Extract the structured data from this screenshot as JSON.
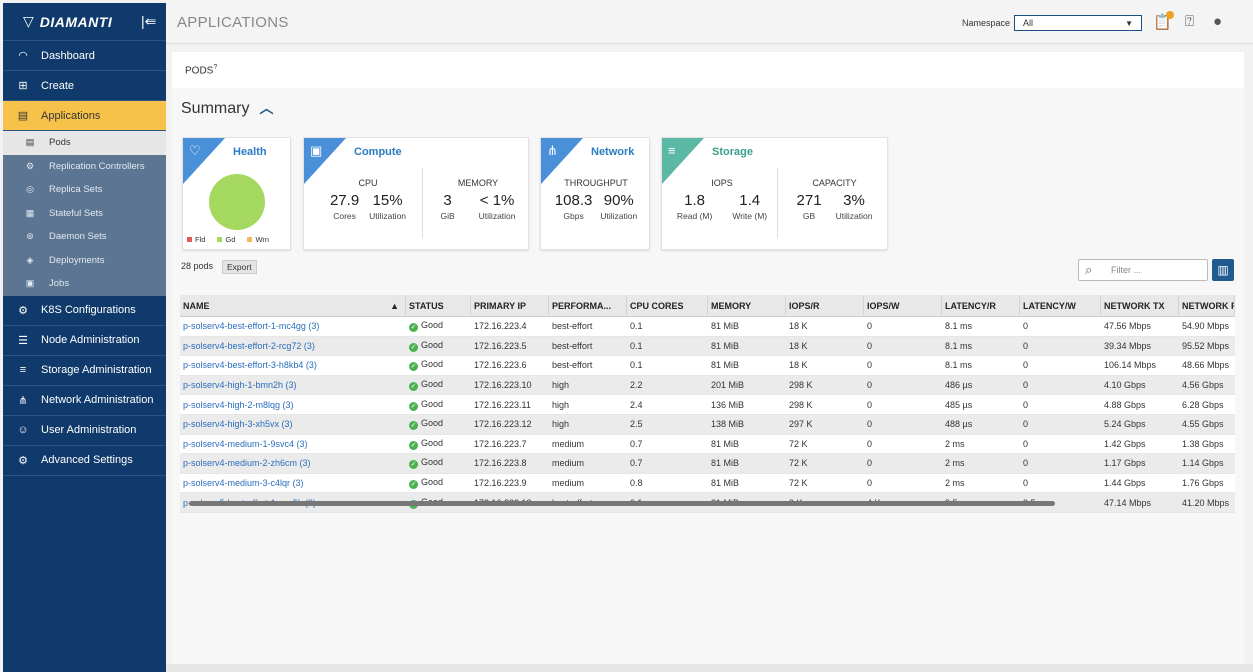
{
  "brand": {
    "name": "DIAMANTI"
  },
  "sidebar": {
    "items": [
      {
        "label": "Dashboard",
        "icon": "gauge-icon"
      },
      {
        "label": "Create",
        "icon": "plus-box-icon"
      },
      {
        "label": "Applications",
        "icon": "document-icon"
      }
    ],
    "sub_items": [
      {
        "label": "Pods"
      },
      {
        "label": "Replication Controllers"
      },
      {
        "label": "Replica Sets"
      },
      {
        "label": "Stateful Sets"
      },
      {
        "label": "Daemon Sets"
      },
      {
        "label": "Deployments"
      },
      {
        "label": "Jobs"
      }
    ],
    "items_after": [
      {
        "label": "K8S Configurations"
      },
      {
        "label": "Node Administration"
      },
      {
        "label": "Storage Administration"
      },
      {
        "label": "Network Administration"
      },
      {
        "label": "User Administration"
      },
      {
        "label": "Advanced Settings"
      }
    ]
  },
  "topbar": {
    "title": "APPLICATIONS",
    "namespace_label": "Namespace",
    "namespace_value": "All"
  },
  "page": {
    "section": "PODS",
    "summary_title": "Summary",
    "pods_count": "28 pods",
    "export_label": "Export",
    "filter_placeholder": "Filter ..."
  },
  "cards": {
    "health": {
      "title": "Health",
      "legend": [
        "Fld",
        "Gd",
        "Wrn"
      ],
      "colors": {
        "fld": "#e05a5a",
        "gd": "#a5d85e",
        "wrn": "#f5b860"
      }
    },
    "compute": {
      "title": "Compute",
      "cpu_label": "CPU",
      "cpu_cores": "27.9",
      "cpu_cores_unit": "Cores",
      "cpu_util": "15%",
      "cpu_util_unit": "Utilization",
      "mem_label": "MEMORY",
      "mem_gib": "3",
      "mem_gib_unit": "GiB",
      "mem_util": "< 1%",
      "mem_util_unit": "Utilization"
    },
    "network": {
      "title": "Network",
      "tp_label": "THROUGHPUT",
      "tp_value": "108.3",
      "tp_unit": "Gbps",
      "tp_util": "90%",
      "tp_util_unit": "Utilization"
    },
    "storage": {
      "title": "Storage",
      "iops_label": "IOPS",
      "iops_read": "1.8",
      "iops_read_unit": "Read (M)",
      "iops_write": "1.4",
      "iops_write_unit": "Write (M)",
      "cap_label": "CAPACITY",
      "cap_gb": "271",
      "cap_gb_unit": "GB",
      "cap_util": "3%",
      "cap_util_unit": "Utilization"
    }
  },
  "table": {
    "headers": [
      "NAME",
      "STATUS",
      "PRIMARY IP",
      "PERFORMA...",
      "CPU CORES",
      "MEMORY",
      "IOPS/R",
      "IOPS/W",
      "LATENCY/R",
      "LATENCY/W",
      "NETWORK TX",
      "NETWORK RX"
    ],
    "rows": [
      [
        "p-solserv4-best-effort-1-mc4gg (3)",
        "Good",
        "172.16.223.4",
        "best-effort",
        "0.1",
        "81 MiB",
        "18 K",
        "0",
        "8.1 ms",
        "0",
        "47.56 Mbps",
        "54.90 Mbps"
      ],
      [
        "p-solserv4-best-effort-2-rcg72 (3)",
        "Good",
        "172.16.223.5",
        "best-effort",
        "0.1",
        "81 MiB",
        "18 K",
        "0",
        "8.1 ms",
        "0",
        "39.34 Mbps",
        "95.52 Mbps"
      ],
      [
        "p-solserv4-best-effort-3-h8kb4 (3)",
        "Good",
        "172.16.223.6",
        "best-effort",
        "0.1",
        "81 MiB",
        "18 K",
        "0",
        "8.1 ms",
        "0",
        "106.14 Mbps",
        "48.66 Mbps"
      ],
      [
        "p-solserv4-high-1-bmn2h (3)",
        "Good",
        "172.16.223.10",
        "high",
        "2.2",
        "201 MiB",
        "298 K",
        "0",
        "486 µs",
        "0",
        "4.10 Gbps",
        "4.56 Gbps"
      ],
      [
        "p-solserv4-high-2-m8lqg (3)",
        "Good",
        "172.16.223.11",
        "high",
        "2.4",
        "136 MiB",
        "298 K",
        "0",
        "485 µs",
        "0",
        "4.88 Gbps",
        "6.28 Gbps"
      ],
      [
        "p-solserv4-high-3-xh5vx (3)",
        "Good",
        "172.16.223.12",
        "high",
        "2.5",
        "138 MiB",
        "297 K",
        "0",
        "488 µs",
        "0",
        "5.24 Gbps",
        "4.55 Gbps"
      ],
      [
        "p-solserv4-medium-1-9svc4 (3)",
        "Good",
        "172.16.223.7",
        "medium",
        "0.7",
        "81 MiB",
        "72 K",
        "0",
        "2 ms",
        "0",
        "1.42 Gbps",
        "1.38 Gbps"
      ],
      [
        "p-solserv4-medium-2-zh6cm (3)",
        "Good",
        "172.16.223.8",
        "medium",
        "0.7",
        "81 MiB",
        "72 K",
        "0",
        "2 ms",
        "0",
        "1.17 Gbps",
        "1.14 Gbps"
      ],
      [
        "p-solserv4-medium-3-c4lqr (3)",
        "Good",
        "172.16.223.9",
        "medium",
        "0.8",
        "81 MiB",
        "72 K",
        "0",
        "2 ms",
        "0",
        "1.44 Gbps",
        "1.76 Gbps"
      ],
      [
        "p-solserv5-best-effort-1-cza5k (3)",
        "Good",
        "172.16.223.13",
        "best-effort",
        "0.1",
        "81 MiB",
        "9 K",
        "4 K",
        "9.5 ms",
        "9.5 ms",
        "47.14 Mbps",
        "41.20 Mbps"
      ]
    ]
  }
}
